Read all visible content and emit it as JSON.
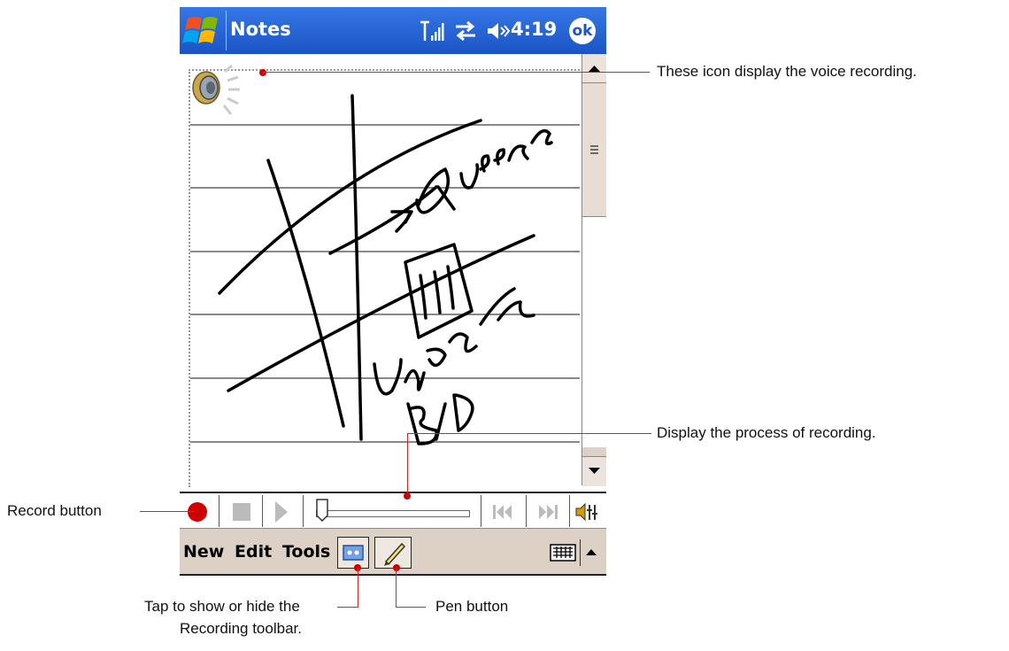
{
  "titlebar": {
    "app_title": "Notes",
    "time": "4:19",
    "ok_label": "ok"
  },
  "menubar": {
    "new": "New",
    "edit": "Edit",
    "tools": "Tools"
  },
  "callouts": {
    "voice_recording": "These icon display the voice recording.",
    "recording_process": "Display the process of recording.",
    "record_button": "Record button",
    "toggle_line1": "Tap to show or hide the",
    "toggle_line2": "Recording toolbar.",
    "pen_button": "Pen button"
  },
  "recording_progress": 0.0,
  "handwriting_words": [
    "Queens",
    "Uptown",
    "B/D"
  ],
  "colors": {
    "titlebar": "#1b54c4",
    "menubar": "#ddd0c4",
    "callout": "#d00000",
    "record": "#cc0000"
  },
  "icons": [
    "windows-start-icon",
    "signal-icon",
    "sync-icon",
    "volume-icon",
    "speaker-icon",
    "record-icon",
    "stop-icon",
    "play-icon",
    "rewind-icon",
    "fast-forward-icon",
    "keyboard-icon",
    "pen-icon"
  ]
}
